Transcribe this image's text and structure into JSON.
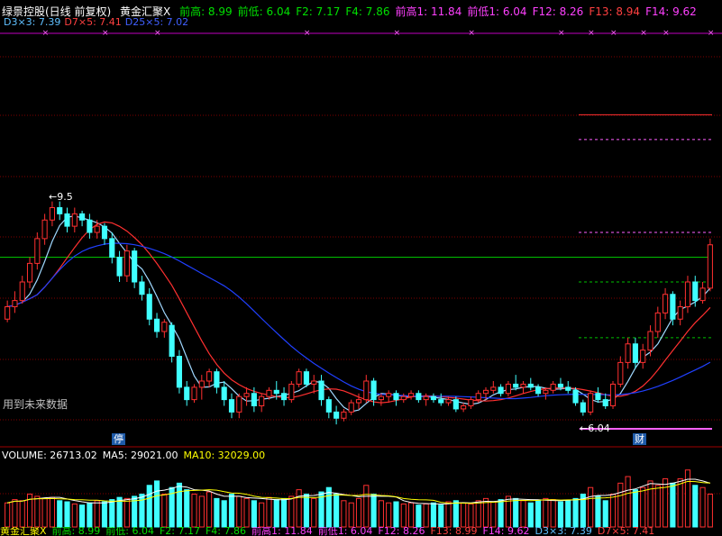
{
  "header": {
    "title": "绿景控股(日线 前复权)",
    "indicator": "黄金汇聚X",
    "items": [
      {
        "label": "前高: 8.99",
        "color": "#00e000"
      },
      {
        "label": "前低: 6.04",
        "color": "#00e000"
      },
      {
        "label": "F2: 7.17",
        "color": "#00e000"
      },
      {
        "label": "F4: 7.86",
        "color": "#00e000"
      },
      {
        "label": "前高1: 11.84",
        "color": "#ff40ff"
      },
      {
        "label": "前低1: 6.04",
        "color": "#ff40ff"
      },
      {
        "label": "F12: 8.26",
        "color": "#ff40ff"
      },
      {
        "label": "F13: 8.94",
        "color": "#ff4040"
      },
      {
        "label": "F14: 9.62",
        "color": "#ff40ff"
      }
    ],
    "line2": [
      {
        "label": "D3×3: 7.39",
        "color": "#60c0ff"
      },
      {
        "label": "D7×5: 7.41",
        "color": "#ff4040"
      },
      {
        "label": "D25×5: 7.02",
        "color": "#4060ff"
      }
    ]
  },
  "price_annotations": {
    "high_label": "9.5",
    "low_label": "6.04",
    "note": "用到未来数据",
    "tag_left": "停",
    "tag_right": "财"
  },
  "volume_header": {
    "items": [
      {
        "label": "VOLUME: 26713.02",
        "color": "#ffffff"
      },
      {
        "label": "MA5: 29021.00",
        "color": "#ffffff"
      },
      {
        "label": "MA10: 32029.00",
        "color": "#ffff00"
      }
    ]
  },
  "footer": {
    "items": [
      {
        "label": "黄金汇聚X",
        "color": "#ffff00"
      },
      {
        "label": "前高: 8.99",
        "color": "#00e000"
      },
      {
        "label": "前低: 6.04",
        "color": "#00e000"
      },
      {
        "label": "F2: 7.17",
        "color": "#00e000"
      },
      {
        "label": "F4: 7.86",
        "color": "#00e000"
      },
      {
        "label": "前高1: 11.84",
        "color": "#ff40ff"
      },
      {
        "label": "前低1: 6.04",
        "color": "#ff40ff"
      },
      {
        "label": "F12: 8.26",
        "color": "#ff40ff"
      },
      {
        "label": "F13: 8.99",
        "color": "#ff4040"
      },
      {
        "label": "F14: 9.62",
        "color": "#ff40ff"
      },
      {
        "label": "D3×3: 7.39",
        "color": "#60c0ff"
      },
      {
        "label": "D7×5: 7.41",
        "color": "#ff4040"
      }
    ]
  },
  "colors": {
    "up": "#ff3030",
    "down": "#40ffff",
    "background": "#000000",
    "grid": "#800000"
  },
  "chart_data": {
    "type": "candlestick",
    "ylim": [
      5.8,
      12.2
    ],
    "candles": [
      [
        7.6,
        7.9,
        7.55,
        7.8
      ],
      [
        7.8,
        8.05,
        7.7,
        7.9
      ],
      [
        7.9,
        8.3,
        7.85,
        8.2
      ],
      [
        8.2,
        8.6,
        8.1,
        8.5
      ],
      [
        8.5,
        9.0,
        8.4,
        8.9
      ],
      [
        8.9,
        9.3,
        8.8,
        9.2
      ],
      [
        9.2,
        9.5,
        9.1,
        9.4
      ],
      [
        9.4,
        9.5,
        9.2,
        9.3
      ],
      [
        9.3,
        9.4,
        9.0,
        9.1
      ],
      [
        9.1,
        9.4,
        9.0,
        9.3
      ],
      [
        9.3,
        9.35,
        9.1,
        9.2
      ],
      [
        9.2,
        9.3,
        8.9,
        9.0
      ],
      [
        9.0,
        9.2,
        8.9,
        9.1
      ],
      [
        9.1,
        9.15,
        8.8,
        8.9
      ],
      [
        8.9,
        9.0,
        8.5,
        8.6
      ],
      [
        8.6,
        8.7,
        8.2,
        8.3
      ],
      [
        8.3,
        8.8,
        8.2,
        8.7
      ],
      [
        8.7,
        8.75,
        8.1,
        8.2
      ],
      [
        8.2,
        8.3,
        7.9,
        8.0
      ],
      [
        8.0,
        8.1,
        7.5,
        7.6
      ],
      [
        7.6,
        7.7,
        7.3,
        7.4
      ],
      [
        7.4,
        7.6,
        7.3,
        7.55
      ],
      [
        7.5,
        7.55,
        6.9,
        7.0
      ],
      [
        7.0,
        7.1,
        6.4,
        6.5
      ],
      [
        6.5,
        6.6,
        6.2,
        6.3
      ],
      [
        6.3,
        6.55,
        6.25,
        6.5
      ],
      [
        6.5,
        6.7,
        6.3,
        6.6
      ],
      [
        6.6,
        6.8,
        6.5,
        6.75
      ],
      [
        6.75,
        6.8,
        6.4,
        6.5
      ],
      [
        6.5,
        6.6,
        6.2,
        6.3
      ],
      [
        6.3,
        6.4,
        6.0,
        6.1
      ],
      [
        6.1,
        6.4,
        6.0,
        6.35
      ],
      [
        6.35,
        6.5,
        6.2,
        6.4
      ],
      [
        6.4,
        6.5,
        6.1,
        6.2
      ],
      [
        6.2,
        6.4,
        6.1,
        6.35
      ],
      [
        6.35,
        6.5,
        6.3,
        6.45
      ],
      [
        6.45,
        6.6,
        6.3,
        6.4
      ],
      [
        6.4,
        6.5,
        6.2,
        6.3
      ],
      [
        6.3,
        6.6,
        6.25,
        6.55
      ],
      [
        6.55,
        6.8,
        6.5,
        6.75
      ],
      [
        6.75,
        6.8,
        6.5,
        6.55
      ],
      [
        6.55,
        6.7,
        6.4,
        6.6
      ],
      [
        6.6,
        6.7,
        6.2,
        6.3
      ],
      [
        6.3,
        6.35,
        6.0,
        6.1
      ],
      [
        6.1,
        6.2,
        5.9,
        6.0
      ],
      [
        6.0,
        6.15,
        5.95,
        6.1
      ],
      [
        6.1,
        6.3,
        6.05,
        6.25
      ],
      [
        6.25,
        6.4,
        6.15,
        6.3
      ],
      [
        6.3,
        6.7,
        6.25,
        6.6
      ],
      [
        6.6,
        6.65,
        6.2,
        6.3
      ],
      [
        6.3,
        6.4,
        6.2,
        6.35
      ],
      [
        6.35,
        6.45,
        6.25,
        6.4
      ],
      [
        6.4,
        6.45,
        6.2,
        6.3
      ],
      [
        6.3,
        6.4,
        6.25,
        6.35
      ],
      [
        6.35,
        6.45,
        6.3,
        6.4
      ],
      [
        6.4,
        6.45,
        6.25,
        6.3
      ],
      [
        6.3,
        6.4,
        6.2,
        6.35
      ],
      [
        6.35,
        6.4,
        6.25,
        6.3
      ],
      [
        6.3,
        6.4,
        6.2,
        6.25
      ],
      [
        6.25,
        6.35,
        6.2,
        6.3
      ],
      [
        6.3,
        6.35,
        6.1,
        6.15
      ],
      [
        6.15,
        6.25,
        6.1,
        6.2
      ],
      [
        6.2,
        6.35,
        6.15,
        6.3
      ],
      [
        6.3,
        6.45,
        6.25,
        6.4
      ],
      [
        6.4,
        6.5,
        6.3,
        6.45
      ],
      [
        6.45,
        6.6,
        6.4,
        6.5
      ],
      [
        6.5,
        6.55,
        6.35,
        6.4
      ],
      [
        6.4,
        6.6,
        6.35,
        6.55
      ],
      [
        6.55,
        6.7,
        6.45,
        6.5
      ],
      [
        6.5,
        6.6,
        6.4,
        6.55
      ],
      [
        6.55,
        6.65,
        6.45,
        6.5
      ],
      [
        6.5,
        6.55,
        6.35,
        6.4
      ],
      [
        6.4,
        6.5,
        6.3,
        6.45
      ],
      [
        6.45,
        6.6,
        6.4,
        6.55
      ],
      [
        6.55,
        6.65,
        6.45,
        6.5
      ],
      [
        6.5,
        6.6,
        6.4,
        6.45
      ],
      [
        6.45,
        6.5,
        6.2,
        6.25
      ],
      [
        6.25,
        6.3,
        6.04,
        6.1
      ],
      [
        6.1,
        6.45,
        6.05,
        6.4
      ],
      [
        6.4,
        6.5,
        6.25,
        6.3
      ],
      [
        6.3,
        6.4,
        6.15,
        6.2
      ],
      [
        6.2,
        6.6,
        6.15,
        6.55
      ],
      [
        6.55,
        7.0,
        6.5,
        6.9
      ],
      [
        6.9,
        7.3,
        6.8,
        7.2
      ],
      [
        7.2,
        7.3,
        6.8,
        6.9
      ],
      [
        6.9,
        7.2,
        6.8,
        7.1
      ],
      [
        7.1,
        7.5,
        7.0,
        7.4
      ],
      [
        7.4,
        7.8,
        7.3,
        7.7
      ],
      [
        7.7,
        8.1,
        7.6,
        8.0
      ],
      [
        8.0,
        8.05,
        7.5,
        7.6
      ],
      [
        7.6,
        7.9,
        7.5,
        7.8
      ],
      [
        7.8,
        8.3,
        7.7,
        8.2
      ],
      [
        8.2,
        8.3,
        7.8,
        7.9
      ],
      [
        7.9,
        8.2,
        7.85,
        8.1
      ],
      [
        8.1,
        8.9,
        8.05,
        8.8
      ]
    ],
    "volume_ylim": [
      0,
      60000
    ],
    "volumes": [
      22000,
      25000,
      24000,
      30000,
      28000,
      26000,
      27000,
      24000,
      23000,
      21000,
      20000,
      22000,
      24000,
      23000,
      25000,
      27000,
      26000,
      28000,
      30000,
      38000,
      42000,
      30000,
      36000,
      40000,
      34000,
      30000,
      28000,
      32000,
      26000,
      24000,
      30000,
      28000,
      26000,
      24000,
      22000,
      27000,
      25000,
      26000,
      28000,
      34000,
      30000,
      26000,
      32000,
      36000,
      30000,
      24000,
      22000,
      26000,
      38000,
      30000,
      24000,
      22000,
      23000,
      21000,
      22000,
      20000,
      21000,
      22000,
      20000,
      23000,
      24000,
      22000,
      21000,
      24000,
      26000,
      23000,
      25000,
      28000,
      26000,
      24000,
      22000,
      24000,
      26000,
      25000,
      23000,
      24000,
      26000,
      30000,
      36000,
      28000,
      24000,
      30000,
      40000,
      46000,
      34000,
      36000,
      42000,
      38000,
      44000,
      40000,
      44000,
      52000,
      38000,
      36000,
      30000
    ],
    "ma_lines": [
      {
        "name": "D3×3",
        "color": "#a0d8ff"
      },
      {
        "name": "D7×5",
        "color": "#ff3030"
      },
      {
        "name": "D25×5",
        "color": "#2040ff"
      }
    ],
    "hlines": [
      {
        "value": 8.6,
        "color": "#00c000",
        "style": "solid",
        "x0": 0
      },
      {
        "value": 10.5,
        "color": "#ff60ff",
        "style": "dashed",
        "x0": 642
      },
      {
        "value": 10.9,
        "color": "#ff3030",
        "style": "solid",
        "x0": 642
      },
      {
        "value": 9.0,
        "color": "#ff60ff",
        "style": "dashed",
        "x0": 642
      },
      {
        "value": 8.2,
        "color": "#00c000",
        "style": "dashed",
        "x0": 642
      },
      {
        "value": 7.3,
        "color": "#00c000",
        "style": "dashed",
        "x0": 642
      }
    ]
  }
}
